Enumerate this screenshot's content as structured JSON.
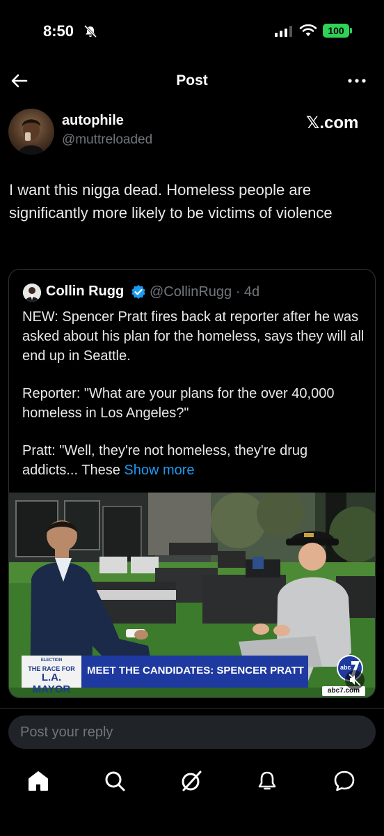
{
  "status_bar": {
    "time": "8:50",
    "battery": "100"
  },
  "nav": {
    "title": "Post"
  },
  "post": {
    "author_name": "autophile",
    "author_handle": "@muttreloaded",
    "watermark": "𝕏.com",
    "text": "I want this nigga dead. Homeless people are significantly more likely to be victims of violence"
  },
  "quote": {
    "author_name": "Collin Rugg",
    "author_handle": "@CollinRugg · 4d",
    "paragraph_1": "NEW: Spencer Pratt fires back at reporter after he was asked about his plan for the homeless, says they will all end up in Seattle.",
    "paragraph_2": "Reporter: \"What are your plans for the over 40,000 homeless in Los Angeles?\"",
    "paragraph_3": "Pratt: \"Well, they're not homeless, they're drug addicts... These",
    "show_more": "Show more",
    "media": {
      "small_caption": "ELECTION",
      "race_label": "THE RACE FOR",
      "race_title": "L.A. MAYOR",
      "headline": "MEET THE CANDIDATES: SPENCER PRATT",
      "station_url": "abc7.com"
    }
  },
  "reply": {
    "placeholder": "Post your reply"
  },
  "colors": {
    "accent": "#1d9bf0",
    "battery": "#30d158",
    "banner": "#1e3aa0"
  }
}
